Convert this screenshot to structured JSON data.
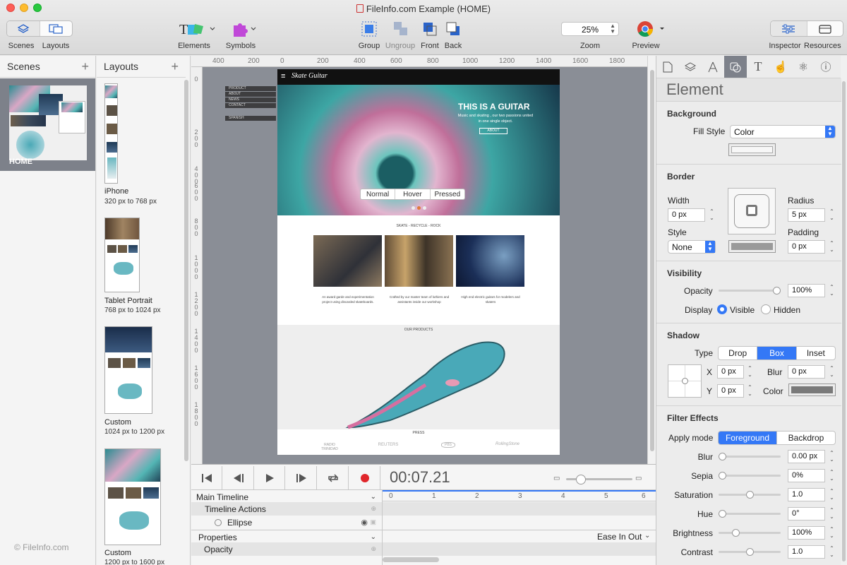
{
  "window": {
    "title": "FileInfo.com Example (HOME)"
  },
  "toolbar": {
    "scenes": "Scenes",
    "layouts": "Layouts",
    "elements": "Elements",
    "symbols": "Symbols",
    "group": "Group",
    "ungroup": "Ungroup",
    "front": "Front",
    "back": "Back",
    "zoom_label": "Zoom",
    "zoom_value": "25%",
    "preview": "Preview",
    "inspector": "Inspector",
    "resources": "Resources"
  },
  "scenes_panel": {
    "title": "Scenes",
    "add": "+",
    "scene_name": "HOME",
    "watermark": "© FileInfo.com"
  },
  "layouts_panel": {
    "title": "Layouts",
    "add": "+",
    "items": [
      {
        "name": "iPhone",
        "dims": "320 px to 768 px"
      },
      {
        "name": "Tablet Portrait",
        "dims": "768 px to 1024 px"
      },
      {
        "name": "Custom",
        "dims": "1024 px to 1200 px"
      },
      {
        "name": "Custom",
        "dims": "1200 px to 1600 px"
      }
    ]
  },
  "ruler": {
    "top": [
      "400",
      "200",
      "0",
      "200",
      "400",
      "600",
      "800",
      "1000",
      "1200",
      "1400",
      "1600",
      "1800"
    ],
    "left": [
      "0",
      "2 0 0",
      "4 0 0",
      "6 0 0",
      "8 0 0",
      "1 0 0 0",
      "1 2 0 0",
      "1 4 0 0",
      "1 6 0 0",
      "1 8 0 0"
    ]
  },
  "canvas": {
    "nav": [
      "PRODUCT",
      "ABOUT",
      "NEWS",
      "CONTACT",
      "SPANISH"
    ],
    "logo": "Skate Guitar",
    "hero_title": "THIS IS A GUITAR",
    "hero_text": "Music and skating , our two passions united in one single object.",
    "hero_button": "ABOUT",
    "state_tabs": [
      "Normal",
      "Hover",
      "Pressed"
    ],
    "tagline": "SKATE - RECYCLE - ROCK",
    "cols": [
      "An award garde and experimentation project using discarded skateboards.",
      "Crafted by our master team of luthiers and assistants inside our workshop",
      "High end electric guitars for modelers and skaters"
    ],
    "products_heading": "OUR PRODUCTS",
    "press_heading": "PRESS",
    "press_logos": [
      "RADIO TRINIDAD",
      "REUTERS",
      "PBS",
      "RollingStone"
    ]
  },
  "timeline": {
    "time": "00:07.21",
    "rows": [
      "Main Timeline",
      "Timeline Actions",
      "Ellipse",
      "Properties",
      "Opacity"
    ],
    "ease": "Ease In Out",
    "ticks": [
      "0",
      "1",
      "2",
      "3",
      "4",
      "5",
      "6"
    ]
  },
  "inspector": {
    "heading": "Element",
    "background": {
      "title": "Background",
      "fill_style_label": "Fill Style",
      "fill_style_value": "Color"
    },
    "border": {
      "title": "Border",
      "width_label": "Width",
      "width_value": "0 px",
      "radius_label": "Radius",
      "radius_value": "5 px",
      "style_label": "Style",
      "style_value": "None",
      "padding_label": "Padding",
      "padding_value": "0 px"
    },
    "visibility": {
      "title": "Visibility",
      "opacity_label": "Opacity",
      "opacity_value": "100%",
      "opacity_level": 1.0,
      "display_label": "Display",
      "visible": "Visible",
      "hidden": "Hidden"
    },
    "shadow": {
      "title": "Shadow",
      "type_label": "Type",
      "types": [
        "Drop",
        "Box",
        "Inset"
      ],
      "active_type": "Box",
      "x_label": "X",
      "x_value": "0 px",
      "y_label": "Y",
      "y_value": "0 px",
      "blur_label": "Blur",
      "blur_value": "0 px",
      "color_label": "Color"
    },
    "filters": {
      "title": "Filter Effects",
      "apply_mode_label": "Apply mode",
      "modes": [
        "Foreground",
        "Backdrop"
      ],
      "active_mode": "Foreground",
      "items": [
        {
          "label": "Blur",
          "value": "0.00 px",
          "level": 0.0
        },
        {
          "label": "Sepia",
          "value": "0%",
          "level": 0.0
        },
        {
          "label": "Saturation",
          "value": "1.0",
          "level": 0.5
        },
        {
          "label": "Hue",
          "value": "0°",
          "level": 0.0
        },
        {
          "label": "Brightness",
          "value": "100%",
          "level": 0.25
        },
        {
          "label": "Contrast",
          "value": "1.0",
          "level": 0.5
        }
      ]
    }
  },
  "colors": {
    "accent": "#3478f6",
    "selection": "#7d818a",
    "canvas_bg": "#8a8e96",
    "record": "#e0262b"
  }
}
